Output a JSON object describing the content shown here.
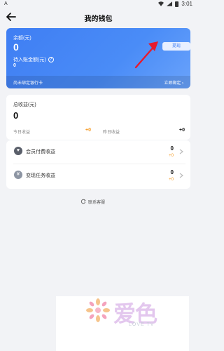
{
  "status_bar": {
    "left_indicator": "A",
    "time": "3:01"
  },
  "nav": {
    "title": "我的钱包"
  },
  "balance_card": {
    "balance_label": "余额(元)",
    "balance_value": "0",
    "pending_label": "待入账金额(元)",
    "pending_value": "0",
    "withdraw_label": "提现",
    "bind_text": "尚未绑定银行卡",
    "bind_link": "立即绑定"
  },
  "earnings_card": {
    "total_label": "总收益(元)",
    "total_value": "0",
    "today_label": "今日收益",
    "today_value": "+0",
    "yesterday_label": "昨日收益",
    "yesterday_value": "+0"
  },
  "income_list": [
    {
      "label": "会员付费收益",
      "amount": "0",
      "delta": "+0"
    },
    {
      "label": "变现任务收益",
      "amount": "0",
      "delta": "+0"
    }
  ],
  "contact": {
    "label": "联系客服"
  },
  "watermark": {
    "cn": "爱色",
    "en": "LOVE TV"
  },
  "colors": {
    "accent": "#3f7ef3",
    "positive": "#f59a23",
    "background": "#f2f3f6"
  }
}
